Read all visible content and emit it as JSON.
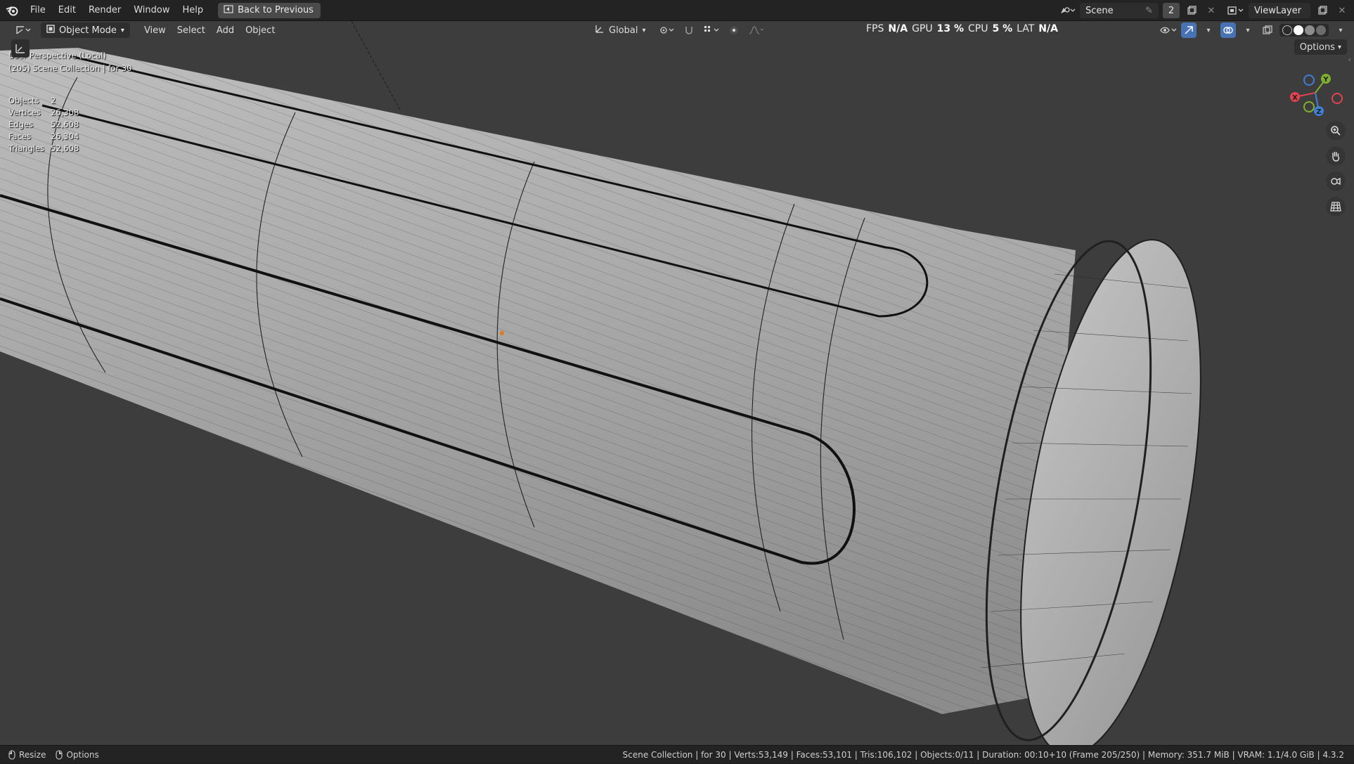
{
  "topbar": {
    "menus": [
      "File",
      "Edit",
      "Render",
      "Window",
      "Help"
    ],
    "back_button": "Back to Previous",
    "scene_field": "Scene",
    "scene_count": "2",
    "view_layer": "ViewLayer"
  },
  "viewport_header": {
    "mode": "Object Mode",
    "menus": [
      "View",
      "Select",
      "Add",
      "Object"
    ],
    "orientation": "Global",
    "stats": {
      "fps_label": "FPS",
      "fps_value": "N/A",
      "gpu_label": "GPU",
      "gpu_value": "13 %",
      "cpu_label": "CPU",
      "cpu_value": "5 %",
      "lat_label": "LAT",
      "lat_value": "N/A"
    },
    "options": "Options"
  },
  "overlay": {
    "view_name": "User Perspective (Local)",
    "collection": "(205) Scene Collection | for 30",
    "stats": [
      {
        "label": "Objects",
        "value": "2"
      },
      {
        "label": "Vertices",
        "value": "26,308"
      },
      {
        "label": "Edges",
        "value": "52,608"
      },
      {
        "label": "Faces",
        "value": "26,304"
      },
      {
        "label": "Triangles",
        "value": "52,608"
      }
    ]
  },
  "gizmo": {
    "x_label": "X",
    "y_label": "Y",
    "z_label": "Z",
    "colors": {
      "x": "#e0424f",
      "y": "#80b12c",
      "z": "#3f7fd6"
    }
  },
  "statusbar": {
    "left": [
      {
        "icon": "mouse-left-icon",
        "label": "Resize"
      },
      {
        "icon": "mouse-right-icon",
        "label": "Options"
      }
    ],
    "right": "Scene Collection | for 30 | Verts:53,149 | Faces:53,101 | Tris:106,102 | Objects:0/11 | Duration: 00:10+10 (Frame 205/250) | Memory: 351.7 MiB | VRAM: 1.1/4.0 GiB | 4.3.2"
  }
}
